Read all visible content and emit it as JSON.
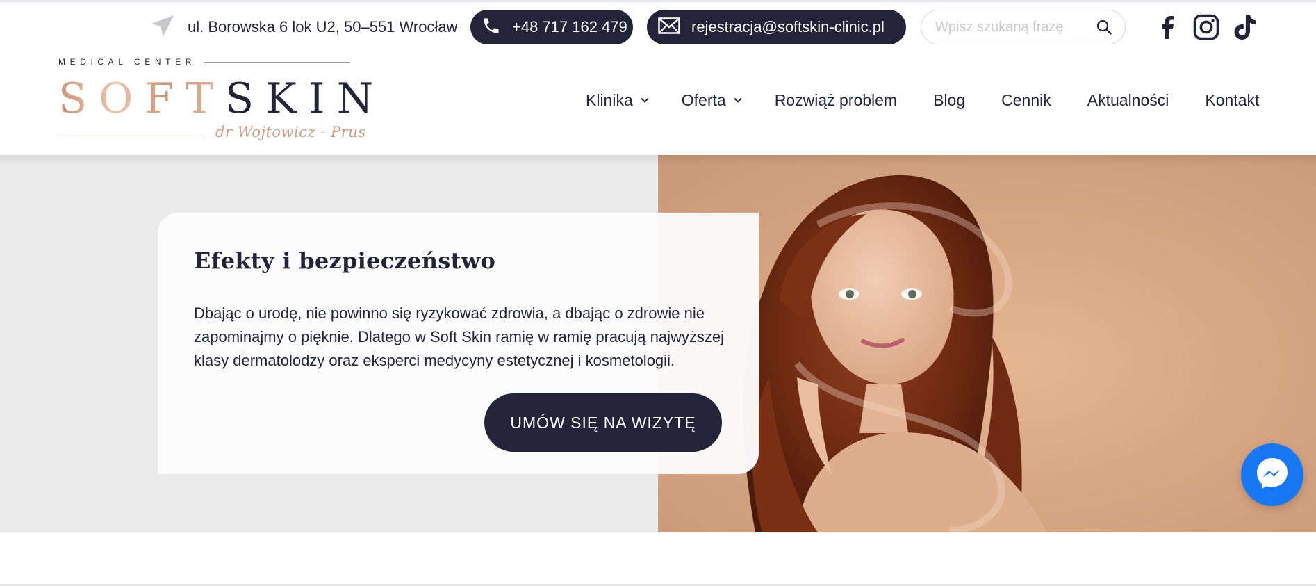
{
  "topbar": {
    "address": "ul. Borowska 6 lok U2, 50–551 Wrocław",
    "phone": "+48 717 162 479",
    "email": "rejestracja@softskin-clinic.pl",
    "search_placeholder": "Wpisz szukaną frazę",
    "social": [
      "facebook-icon",
      "instagram-icon",
      "tiktok-icon"
    ]
  },
  "logo": {
    "kicker": "MEDICAL CENTER",
    "word_part1": "SOFT",
    "word_part2": "SKIN",
    "signature": "dr Wojtowicz - Prus"
  },
  "nav": {
    "items": [
      {
        "label": "Klinika",
        "has_dropdown": true
      },
      {
        "label": "Oferta",
        "has_dropdown": true
      },
      {
        "label": "Rozwiąż problem",
        "has_dropdown": false
      },
      {
        "label": "Blog",
        "has_dropdown": false
      },
      {
        "label": "Cennik",
        "has_dropdown": false
      },
      {
        "label": "Aktualności",
        "has_dropdown": false
      },
      {
        "label": "Kontakt",
        "has_dropdown": false
      }
    ]
  },
  "hero": {
    "title": "Efekty i bezpieczeństwo",
    "text": "Dbając o urodę, nie powinno się ryzykować zdrowia, a dbając o zdrowie nie zapominajmy o pięknie. Dlatego w Soft Skin ramię w ramię pracują najwyższej klasy dermatolodzy oraz eksperci medycyny estetycznej i kosmetologii.",
    "cta": "UMÓW SIĘ NA WIZYTĘ"
  },
  "colors": {
    "primary": "#23243a",
    "accent": "#c99c85",
    "hero_bg": "#ebebeb",
    "messenger": "#1877f2"
  }
}
